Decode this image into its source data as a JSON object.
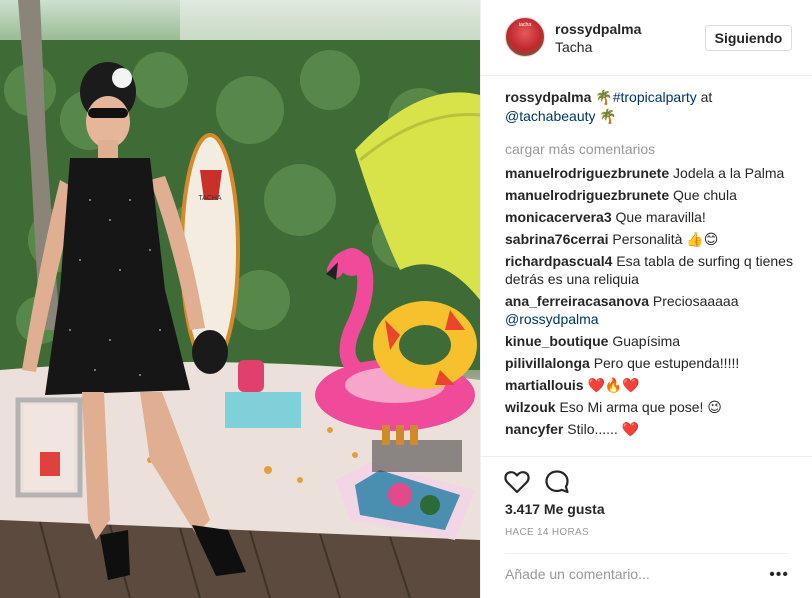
{
  "header": {
    "username": "rossydpalma",
    "location": "Tacha",
    "follow_label": "Siguiendo",
    "avatar_text": "tacha"
  },
  "caption": {
    "username": "rossydpalma",
    "emoji_1": "🌴",
    "hashtag": "#tropicalparty",
    "at_text": " at",
    "mention": "@tachabeauty",
    "emoji_2": "🌴"
  },
  "load_more_label": "cargar más comentarios",
  "comments": [
    {
      "user": "manuelrodriguezbrunete",
      "text": "Jodela a la Palma"
    },
    {
      "user": "manuelrodriguezbrunete",
      "text": "Que chula"
    },
    {
      "user": "monicacervera3",
      "text": "Que maravilla!"
    },
    {
      "user": "sabrina76cerrai",
      "text": "Personalità 👍😊"
    },
    {
      "user": "richardpascual4",
      "text": "Esa tabla de surfing q tienes detrás es una reliquia"
    },
    {
      "user": "ana_ferreiracasanova",
      "text": "Preciosaaaaa",
      "mention": "@rossydpalma"
    },
    {
      "user": "kinue_boutique",
      "text": "Guapísima"
    },
    {
      "user": "pilivillalonga",
      "text": "Pero que estupenda!!!!!"
    },
    {
      "user": "martiallouis",
      "text": "❤️🔥❤️"
    },
    {
      "user": "wilzouk",
      "text": "Eso Mi arma que pose! 😉"
    },
    {
      "user": "nancyfer",
      "text": "Stilo...... ❤️"
    }
  ],
  "actions": {
    "likes_text": "3.417 Me gusta",
    "time_text": "HACE 14 HORAS",
    "comment_placeholder": "Añade un comentario...",
    "more_label": "•••",
    "like_icon": "heart-icon",
    "comment_icon": "speech-bubble-icon"
  },
  "photo_board_text": "TACHA",
  "colors": {
    "link": "#003569",
    "muted": "#999999",
    "border": "#efefef",
    "text": "#262626"
  }
}
